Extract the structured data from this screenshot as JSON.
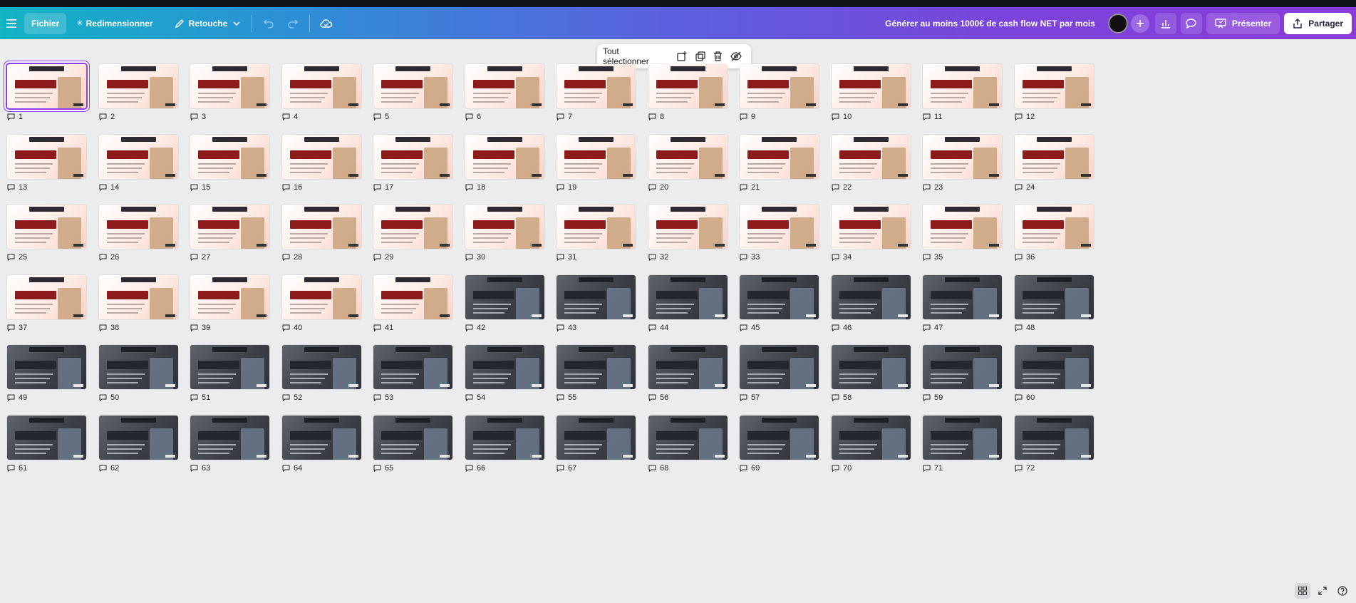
{
  "toolbar": {
    "file_label": "Fichier",
    "resize_label": "Redimensionner",
    "edit_label": "Retouche",
    "document_title": "Générer au moins 1000€ de cash flow NET par mois",
    "present_label": "Présenter",
    "share_label": "Partager"
  },
  "floating_toolbar": {
    "select_all_label": "Tout sélectionner"
  },
  "grid": {
    "selected_page": 1,
    "dark_from_page": 42,
    "pages": [
      "1",
      "2",
      "3",
      "4",
      "5",
      "6",
      "7",
      "8",
      "9",
      "10",
      "11",
      "12",
      "13",
      "14",
      "15",
      "16",
      "17",
      "18",
      "19",
      "20",
      "21",
      "22",
      "23",
      "24",
      "25",
      "26",
      "27",
      "28",
      "29",
      "30",
      "31",
      "32",
      "33",
      "34",
      "35",
      "36",
      "37",
      "38",
      "39",
      "40",
      "41",
      "42",
      "43",
      "44",
      "45",
      "46",
      "47",
      "48",
      "49",
      "50",
      "51",
      "52",
      "53",
      "54",
      "55",
      "56",
      "57",
      "58",
      "59",
      "60",
      "61",
      "62",
      "63",
      "64",
      "65",
      "66",
      "67",
      "68",
      "69",
      "70",
      "71",
      "72"
    ]
  },
  "colors": {
    "accent": "#8b3dff",
    "slide_red": "#8e1b1b"
  },
  "icons": [
    "menu-icon",
    "star-icon",
    "pen-icon",
    "chevron-down-icon",
    "undo-icon",
    "redo-icon",
    "cloud-check-icon",
    "plus-icon",
    "chart-icon",
    "comment-icon",
    "present-icon",
    "share-icon",
    "add-page-icon",
    "duplicate-icon",
    "trash-icon",
    "hide-icon",
    "grid-view-icon",
    "fullscreen-icon",
    "help-icon"
  ]
}
